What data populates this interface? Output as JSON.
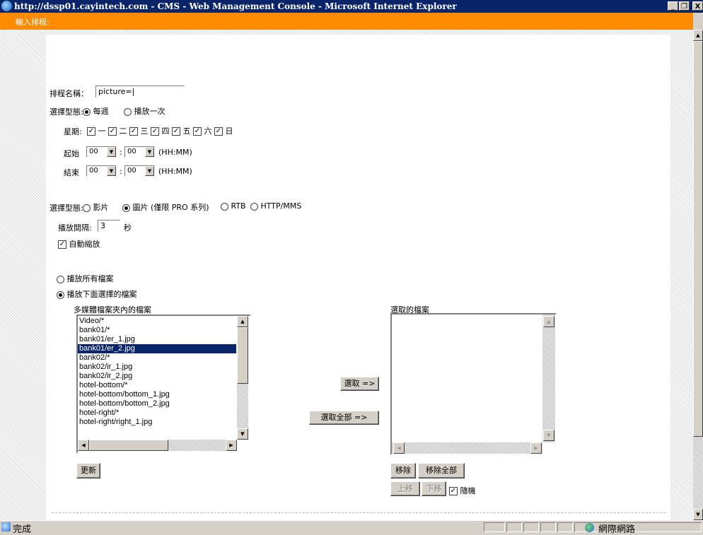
{
  "window": {
    "title": "http://dssp01.cayintech.com - CMS - Web Management Console - Microsoft Internet Explorer",
    "min": "_",
    "restore": "❐",
    "close": "X"
  },
  "header": {
    "title": "輸入排程:"
  },
  "form": {
    "name_label": "排程名稱：",
    "name_value": "picture=|",
    "type_label": "選擇型態:",
    "type_weekly": "每週",
    "type_once": "播放一次",
    "weekday_label": "星期:",
    "weekdays": [
      "一",
      "二",
      "三",
      "四",
      "五",
      "六",
      "日"
    ],
    "start_label": "起始",
    "end_label": "結束",
    "hour_value": "00",
    "minute_value": "00",
    "time_sep": ":",
    "time_format": "(HH:MM)",
    "media_type_label": "選擇型態:",
    "media_video": "影片",
    "media_picture": "圖片 (僅限 PRO 系列)",
    "media_rtb": "RTB",
    "media_http": "HTTP/MMS",
    "interval_label": "播放間隔:",
    "interval_value": "3",
    "interval_unit": "秒",
    "auto_zoom": "自動縮放",
    "play_all": "播放所有檔案",
    "play_selected": "播放下面選擇的檔案",
    "source_list_label": "多媒體檔案夾內的檔案",
    "selected_list_label": "選取的檔案",
    "source_files": [
      "Video/*",
      "bank01/*",
      "bank01/er_1.jpg",
      "bank01/er_2.jpg",
      "bank02/*",
      "bank02/ir_1.jpg",
      "bank02/ir_2.jpg",
      "hotel-bottom/*",
      "hotel-bottom/bottom_1.jpg",
      "hotel-bottom/bottom_2.jpg",
      "hotel-right/*",
      "hotel-right/right_1.jpg"
    ],
    "selected_source_file": "bank01/er_2.jpg",
    "select_button": "選取 =>",
    "select_all_button": "選取全部 =>",
    "refresh_button": "更新",
    "remove_button": "移除",
    "remove_all_button": "移除全部",
    "move_up_button": "上移",
    "move_down_button": "下移",
    "random_label": "隨機"
  },
  "status": {
    "text": "完成",
    "zone": "網際網路"
  },
  "colors": {
    "titlebar": "#0a246a",
    "header_bar": "#ff8c00",
    "selection": "#0a246a"
  }
}
